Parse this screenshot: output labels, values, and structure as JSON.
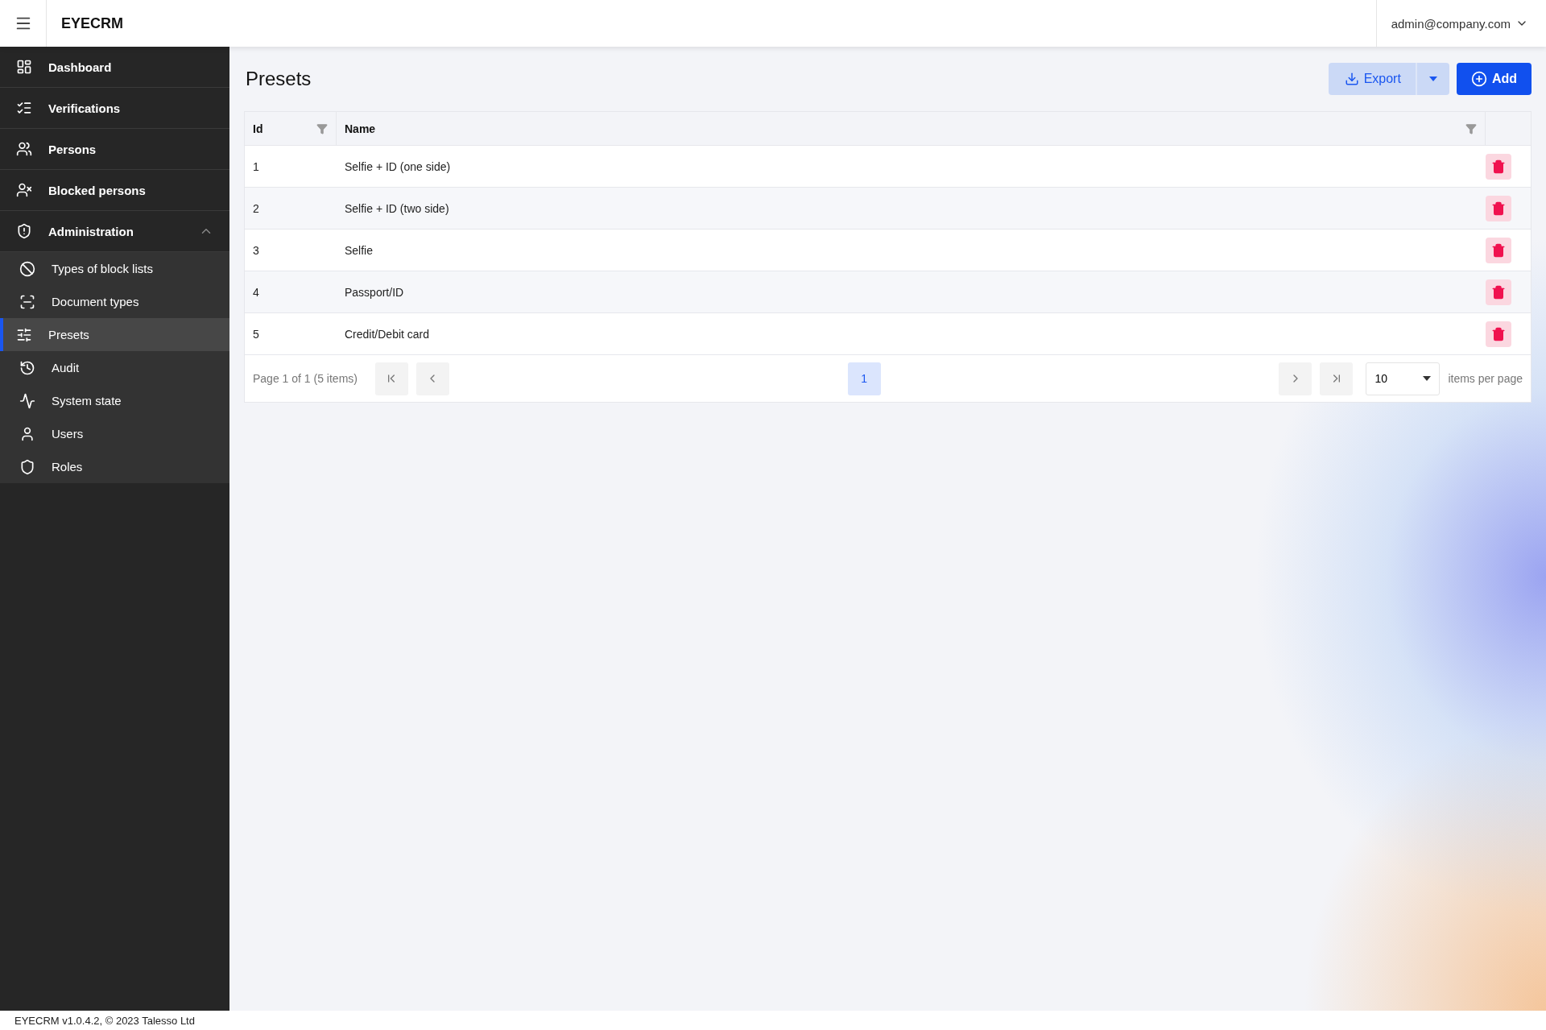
{
  "header": {
    "brand": "EYECRM",
    "user": "admin@company.com"
  },
  "sidebar": {
    "items": [
      {
        "label": "Dashboard",
        "selected": false
      },
      {
        "label": "Verifications",
        "selected": false
      },
      {
        "label": "Persons",
        "selected": false
      },
      {
        "label": "Blocked persons",
        "selected": false
      },
      {
        "label": "Administration",
        "selected": false,
        "expanded": true,
        "children": [
          {
            "label": "Types of block lists",
            "selected": false
          },
          {
            "label": "Document types",
            "selected": false
          },
          {
            "label": "Presets",
            "selected": true
          },
          {
            "label": "Audit",
            "selected": false
          },
          {
            "label": "System state",
            "selected": false
          },
          {
            "label": "Users",
            "selected": false
          },
          {
            "label": "Roles",
            "selected": false
          }
        ]
      }
    ]
  },
  "page": {
    "title": "Presets",
    "export_label": "Export",
    "add_label": "Add"
  },
  "table": {
    "columns": [
      "Id",
      "Name"
    ],
    "rows": [
      {
        "id": "1",
        "name": "Selfie + ID (one side)"
      },
      {
        "id": "2",
        "name": "Selfie + ID (two side)"
      },
      {
        "id": "3",
        "name": "Selfie"
      },
      {
        "id": "4",
        "name": "Passport/ID"
      },
      {
        "id": "5",
        "name": "Credit/Debit card"
      }
    ]
  },
  "pager": {
    "info": "Page 1 of 1 (5 items)",
    "pages": [
      {
        "label": "1",
        "selected": true
      }
    ],
    "page_size": "10",
    "page_size_label": "items per page"
  },
  "footer": "EYECRM v1.0.4.2, © 2023 Talesso Ltd"
}
